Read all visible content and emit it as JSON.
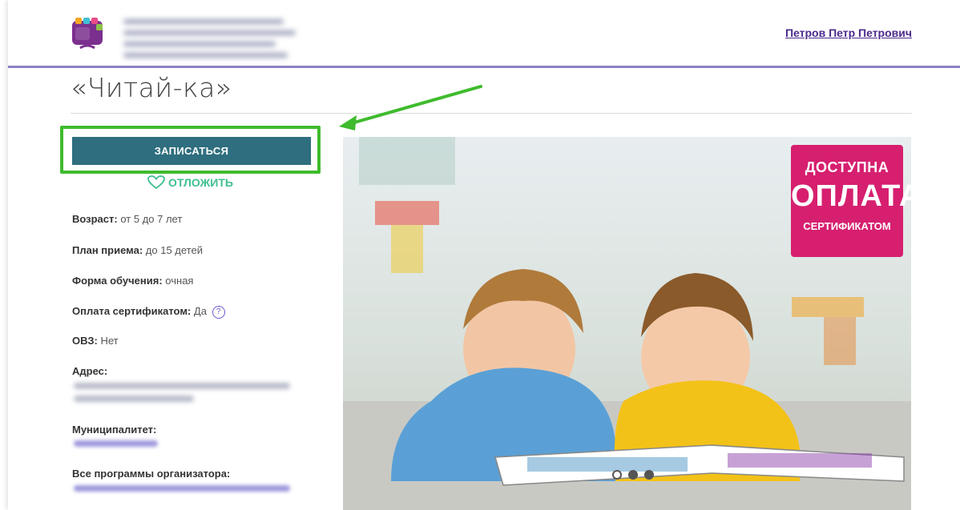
{
  "header": {
    "user_name": "Петров Петр Петрович"
  },
  "program": {
    "title": "«Читай-ка»",
    "enroll_label": "ЗАПИСАТЬСЯ",
    "defer_label": "ОТЛОЖИТЬ"
  },
  "details": {
    "age_label": "Возраст:",
    "age_value": "от 5 до 7 лет",
    "plan_label": "План приема:",
    "plan_value": "до 15 детей",
    "form_label": "Форма обучения:",
    "form_value": "очная",
    "cert_label": "Оплата сертификатом:",
    "cert_value": "Да",
    "help_glyph": "?",
    "ovz_label": "ОВЗ:",
    "ovz_value": "Нет",
    "address_label": "Адрес:",
    "municipality_label": "Муниципалитет:",
    "all_programs_label": "Все программы организатора:"
  },
  "banner": {
    "line1": "ДОСТУПНА",
    "line2": "ОПЛАТА",
    "line3": "СЕРТИФИКАТОМ"
  },
  "colors": {
    "accent_primary": "#2e6e7e",
    "highlight": "#3fbb2d",
    "defer": "#3fbf8f",
    "banner_bg": "#d61f6f",
    "header_rule": "#8a82c4"
  },
  "carousel": {
    "slides": 3,
    "active_index": 0
  }
}
